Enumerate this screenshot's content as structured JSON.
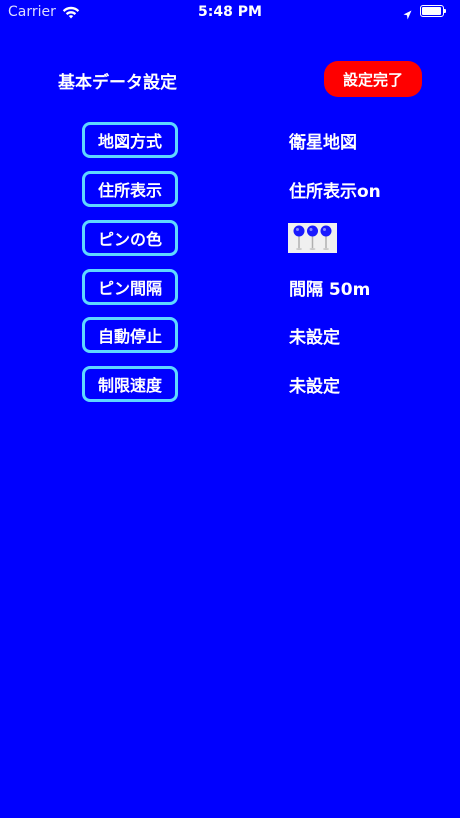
{
  "status_bar": {
    "carrier": "Carrier",
    "time": "5:48 PM",
    "wifi_icon": "wifi-icon",
    "location_icon": "location-arrow-icon",
    "battery_icon": "battery-full-icon"
  },
  "header": {
    "title": "基本データ設定",
    "done_label": "設定完了",
    "done_color": "#ff0000"
  },
  "settings": [
    {
      "label": "地図方式",
      "value": "衛星地図"
    },
    {
      "label": "住所表示",
      "value": "住所表示on"
    },
    {
      "label": "ピンの色",
      "value": "",
      "value_icon": "blue-pins-icon"
    },
    {
      "label": "ピン間隔",
      "value": "間隔 50m"
    },
    {
      "label": "自動停止",
      "value": "未設定"
    },
    {
      "label": "制限速度",
      "value": "未設定"
    }
  ],
  "colors": {
    "background": "#0000ff",
    "button_border": "#5fd8ff",
    "pin": "#1a1aff"
  }
}
